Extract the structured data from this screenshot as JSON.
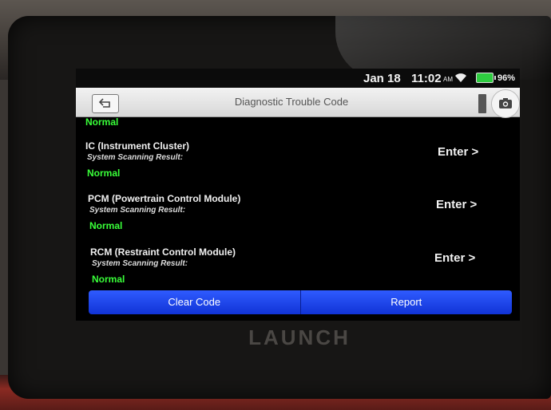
{
  "status_bar": {
    "date": "Jan 18",
    "time": "11:02",
    "ampm": "AM",
    "battery": "96%"
  },
  "header": {
    "title": "Diagnostic Trouble Code"
  },
  "list": {
    "top_status": "Normal",
    "modules": [
      {
        "name": "IC (Instrument Cluster)",
        "sub": "System Scanning Result:",
        "status": "Normal",
        "action": "Enter >"
      },
      {
        "name": "PCM (Powertrain Control Module)",
        "sub": "System Scanning Result:",
        "status": "Normal",
        "action": "Enter >"
      },
      {
        "name": "RCM (Restraint Control Module)",
        "sub": "System Scanning Result:",
        "status": "Normal",
        "action": "Enter >"
      }
    ]
  },
  "buttons": {
    "clear": "Clear Code",
    "report": "Report"
  },
  "device": {
    "brand": "LAUNCH"
  },
  "colors": {
    "accent": "#1f44ee",
    "status_ok": "#39ff39"
  },
  "icons": [
    "back-icon",
    "camera-icon",
    "wifi-icon",
    "battery-icon"
  ]
}
